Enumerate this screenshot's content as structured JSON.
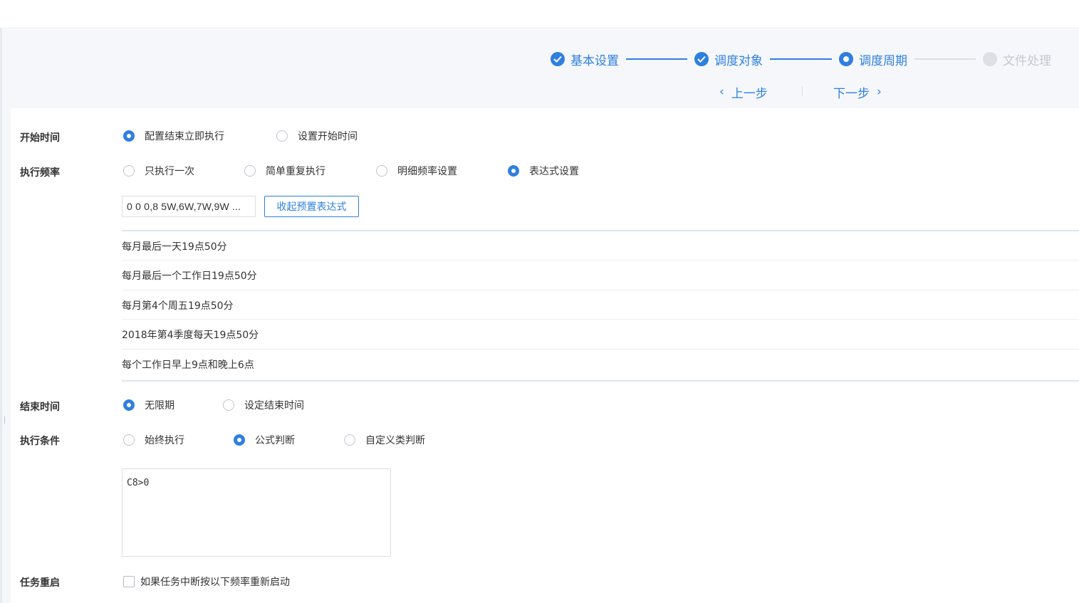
{
  "colors": {
    "accent": "#2f7fe0",
    "inactive": "#c4c8cf",
    "text": "#333333"
  },
  "steps": [
    {
      "label": "基本设置",
      "status": "done",
      "icon": "check-circle-icon"
    },
    {
      "label": "调度对象",
      "status": "done",
      "icon": "check-circle-icon"
    },
    {
      "label": "调度周期",
      "status": "active",
      "icon": "dot-circle-icon"
    },
    {
      "label": "文件处理",
      "status": "todo",
      "icon": "gray-circle-icon"
    }
  ],
  "nav": {
    "prev_label": "上一步",
    "next_label": "下一步",
    "prev_icon": "chevron-left-icon",
    "next_icon": "chevron-right-icon"
  },
  "form": {
    "start_time": {
      "label": "开始时间",
      "options": [
        "配置结束立即执行",
        "设置开始时间"
      ],
      "selected": "配置结束立即执行"
    },
    "frequency": {
      "label": "执行频率",
      "options": [
        "只执行一次",
        "简单重复执行",
        "明细频率设置",
        "表达式设置"
      ],
      "selected": "表达式设置",
      "expression_value": "0 0 0,8 5W,6W,7W,9W ...",
      "collapse_label": "收起预置表达式",
      "presets": [
        "每月最后一天19点50分",
        "每月最后一个工作日19点50分",
        "每月第4个周五19点50分",
        "2018年第4季度每天19点50分",
        "每个工作日早上9点和晚上6点"
      ]
    },
    "end_time": {
      "label": "结束时间",
      "options": [
        "无限期",
        "设定结束时间"
      ],
      "selected": "无限期"
    },
    "condition": {
      "label": "执行条件",
      "options": [
        "始终执行",
        "公式判断",
        "自定义类判断"
      ],
      "selected": "公式判断",
      "formula": "C8>0"
    },
    "restart": {
      "label": "任务重启",
      "checkbox_label": "如果任务中断按以下频率重新启动",
      "checked": false
    }
  }
}
